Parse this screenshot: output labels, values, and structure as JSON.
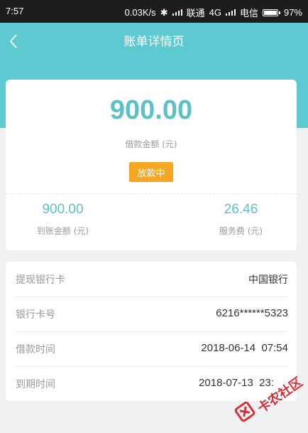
{
  "status_bar": {
    "time": "7:57",
    "network_speed": "0.03K/s",
    "carrier_1": "联通",
    "network_type": "4G",
    "carrier_2": "电信",
    "battery": "97%"
  },
  "header": {
    "title": "账单详情页",
    "back_icon": "chevron-left-icon",
    "background_color": "#5dc9d1"
  },
  "summary": {
    "amount": "900.00",
    "amount_label": "借款金额 (元)",
    "status_badge": "放款中",
    "received_amount": "900.00",
    "received_label": "到账金额 (元)",
    "service_fee": "26.46",
    "service_fee_label": "服务费 (元)",
    "accent_color": "#5cc1c6",
    "badge_color": "#f5a623"
  },
  "details": [
    {
      "label": "提现银行卡",
      "value": "中国银行"
    },
    {
      "label": "银行卡号",
      "value": "6216******5323"
    },
    {
      "label": "借款时间",
      "value": "2018-06-14  07:54"
    },
    {
      "label": "到期时间",
      "value": "2018-07-13  23:"
    }
  ],
  "watermark": {
    "text": "卡农社区",
    "color": "#d3313a"
  }
}
